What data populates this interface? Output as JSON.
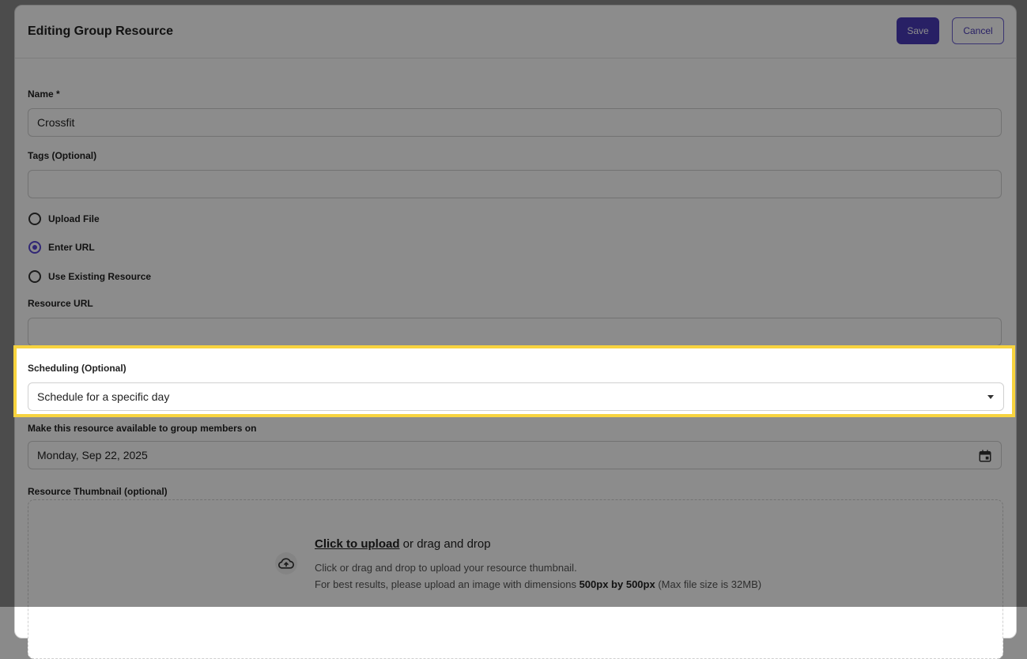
{
  "header": {
    "title": "Editing Group Resource",
    "save_label": "Save",
    "cancel_label": "Cancel"
  },
  "form": {
    "name_label": "Name *",
    "name_value": "Crossfit",
    "tags_label": "Tags (Optional)",
    "tags_value": "",
    "source_options": [
      {
        "label": "Upload File",
        "checked": false
      },
      {
        "label": "Enter URL",
        "checked": true
      },
      {
        "label": "Use Existing Resource",
        "checked": false
      }
    ],
    "resource_url_label": "Resource URL",
    "resource_url_value": "",
    "scheduling_label": "Scheduling (Optional)",
    "scheduling_value": "Schedule for a specific day",
    "available_label": "Make this resource available to group members on",
    "available_value": "Monday, Sep 22, 2025",
    "thumbnail_label": "Resource Thumbnail (optional)"
  },
  "upload": {
    "link_text": "Click to upload",
    "title_rest": " or drag and drop",
    "desc_line1": "Click or drag and drop to upload your resource thumbnail.",
    "desc_line2_pre": "For best results, please upload an image with dimensions ",
    "desc_line2_bold": "500px by 500px",
    "desc_line2_post": " (Max file size is 32MB)"
  },
  "colors": {
    "accent": "#4a3bb8",
    "highlight": "#f7d33f"
  },
  "icons": {
    "dropdown": "caret-down-icon",
    "calendar": "calendar-icon",
    "upload": "cloud-upload-icon"
  }
}
